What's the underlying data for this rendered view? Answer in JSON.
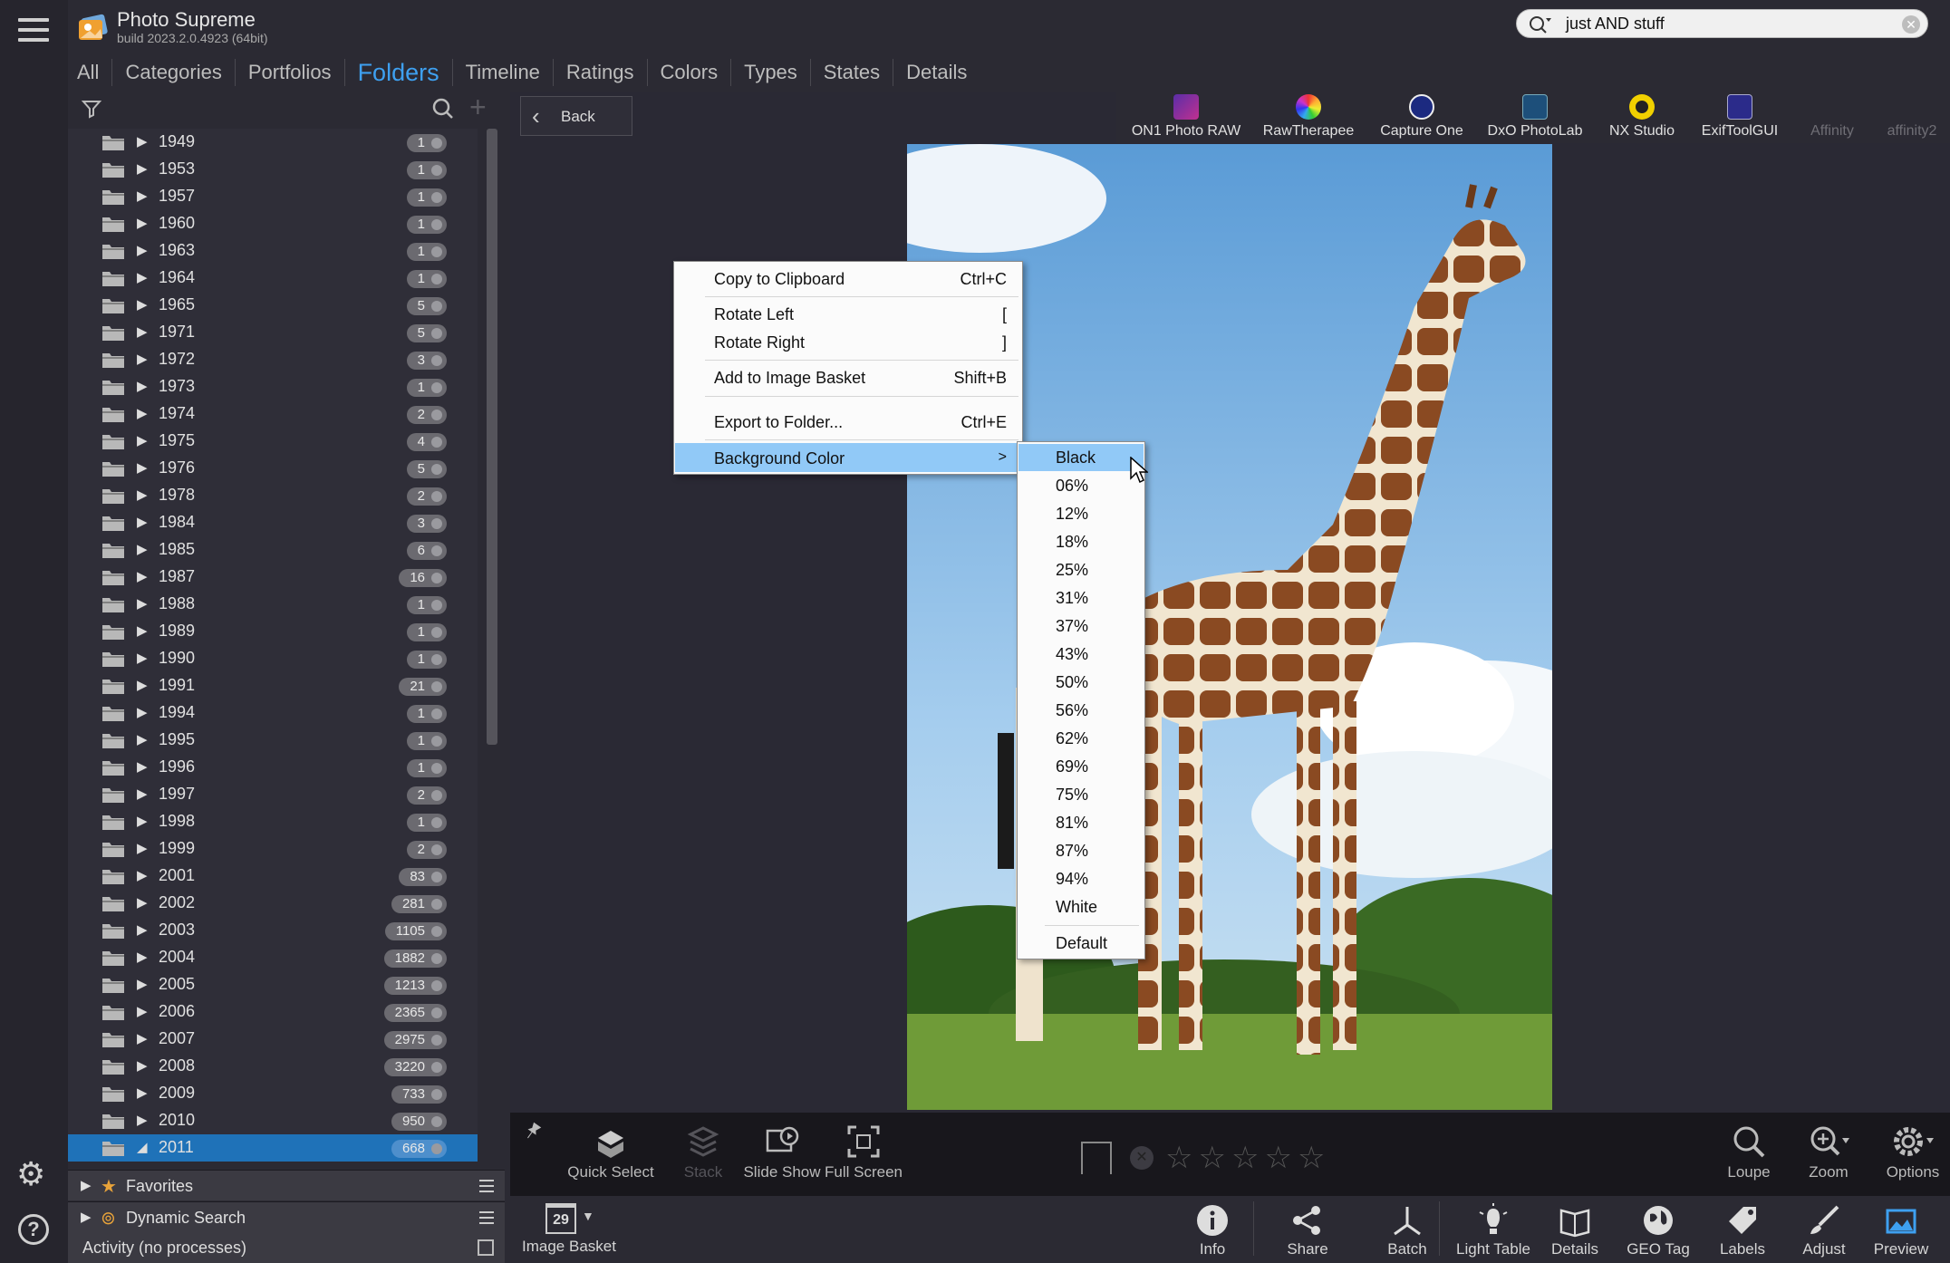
{
  "app": {
    "title": "Photo Supreme",
    "build": "build 2023.2.0.4923 (64bit)"
  },
  "search": {
    "value": "just AND stuff"
  },
  "tabs": [
    {
      "label": "All"
    },
    {
      "label": "Categories"
    },
    {
      "label": "Portfolios"
    },
    {
      "label": "Folders",
      "active": true
    },
    {
      "label": "Timeline"
    },
    {
      "label": "Ratings"
    },
    {
      "label": "Colors"
    },
    {
      "label": "Types"
    },
    {
      "label": "States"
    },
    {
      "label": "Details"
    }
  ],
  "folders": [
    {
      "year": "1949",
      "count": "1"
    },
    {
      "year": "1953",
      "count": "1"
    },
    {
      "year": "1957",
      "count": "1"
    },
    {
      "year": "1960",
      "count": "1"
    },
    {
      "year": "1963",
      "count": "1"
    },
    {
      "year": "1964",
      "count": "1"
    },
    {
      "year": "1965",
      "count": "5"
    },
    {
      "year": "1971",
      "count": "5"
    },
    {
      "year": "1972",
      "count": "3"
    },
    {
      "year": "1973",
      "count": "1"
    },
    {
      "year": "1974",
      "count": "2"
    },
    {
      "year": "1975",
      "count": "4"
    },
    {
      "year": "1976",
      "count": "5"
    },
    {
      "year": "1978",
      "count": "2"
    },
    {
      "year": "1984",
      "count": "3"
    },
    {
      "year": "1985",
      "count": "6"
    },
    {
      "year": "1987",
      "count": "16"
    },
    {
      "year": "1988",
      "count": "1"
    },
    {
      "year": "1989",
      "count": "1"
    },
    {
      "year": "1990",
      "count": "1"
    },
    {
      "year": "1991",
      "count": "21"
    },
    {
      "year": "1994",
      "count": "1"
    },
    {
      "year": "1995",
      "count": "1"
    },
    {
      "year": "1996",
      "count": "1"
    },
    {
      "year": "1997",
      "count": "2"
    },
    {
      "year": "1998",
      "count": "1"
    },
    {
      "year": "1999",
      "count": "2"
    },
    {
      "year": "2001",
      "count": "83"
    },
    {
      "year": "2002",
      "count": "281"
    },
    {
      "year": "2003",
      "count": "1105"
    },
    {
      "year": "2004",
      "count": "1882"
    },
    {
      "year": "2005",
      "count": "1213"
    },
    {
      "year": "2006",
      "count": "2365"
    },
    {
      "year": "2007",
      "count": "2975"
    },
    {
      "year": "2008",
      "count": "3220"
    },
    {
      "year": "2009",
      "count": "733"
    },
    {
      "year": "2010",
      "count": "950"
    },
    {
      "year": "2011",
      "count": "668",
      "selected": true,
      "expanded": true
    }
  ],
  "sections": {
    "favorites": "Favorites",
    "dynamic_search": "Dynamic Search",
    "activity": "Activity (no processes)"
  },
  "viewer": {
    "back_label": "Back",
    "editors": [
      {
        "label": "ON1 Photo RAW"
      },
      {
        "label": "RawTherapee"
      },
      {
        "label": "Capture One"
      },
      {
        "label": "DxO PhotoLab"
      },
      {
        "label": "NX Studio"
      },
      {
        "label": "ExifToolGUI"
      },
      {
        "label": "Affinity"
      },
      {
        "label": "affinity2"
      }
    ]
  },
  "context_menu": {
    "items": [
      {
        "label": "Copy to Clipboard",
        "shortcut": "Ctrl+C"
      },
      {
        "label": "Rotate Left",
        "shortcut": "["
      },
      {
        "label": "Rotate Right",
        "shortcut": "]"
      },
      {
        "label": "Add to Image Basket",
        "shortcut": "Shift+B"
      },
      {
        "label": "Export to Folder...",
        "shortcut": "Ctrl+E"
      },
      {
        "label": "Background Color",
        "shortcut": ">"
      }
    ],
    "submenu": [
      "Black",
      "06%",
      "12%",
      "18%",
      "25%",
      "31%",
      "37%",
      "43%",
      "50%",
      "56%",
      "62%",
      "69%",
      "75%",
      "81%",
      "87%",
      "94%",
      "White",
      "Default"
    ]
  },
  "toolbar": {
    "quick_select": "Quick Select",
    "stack": "Stack",
    "slide_show": "Slide Show",
    "full_screen": "Full Screen",
    "loupe": "Loupe",
    "zoom": "Zoom",
    "options": "Options"
  },
  "bottom_nav": {
    "basket_count": "29",
    "image_basket": "Image Basket",
    "info": "Info",
    "share": "Share",
    "batch": "Batch",
    "light_table": "Light Table",
    "details": "Details",
    "geo_tag": "GEO Tag",
    "labels": "Labels",
    "adjust": "Adjust",
    "preview": "Preview"
  }
}
